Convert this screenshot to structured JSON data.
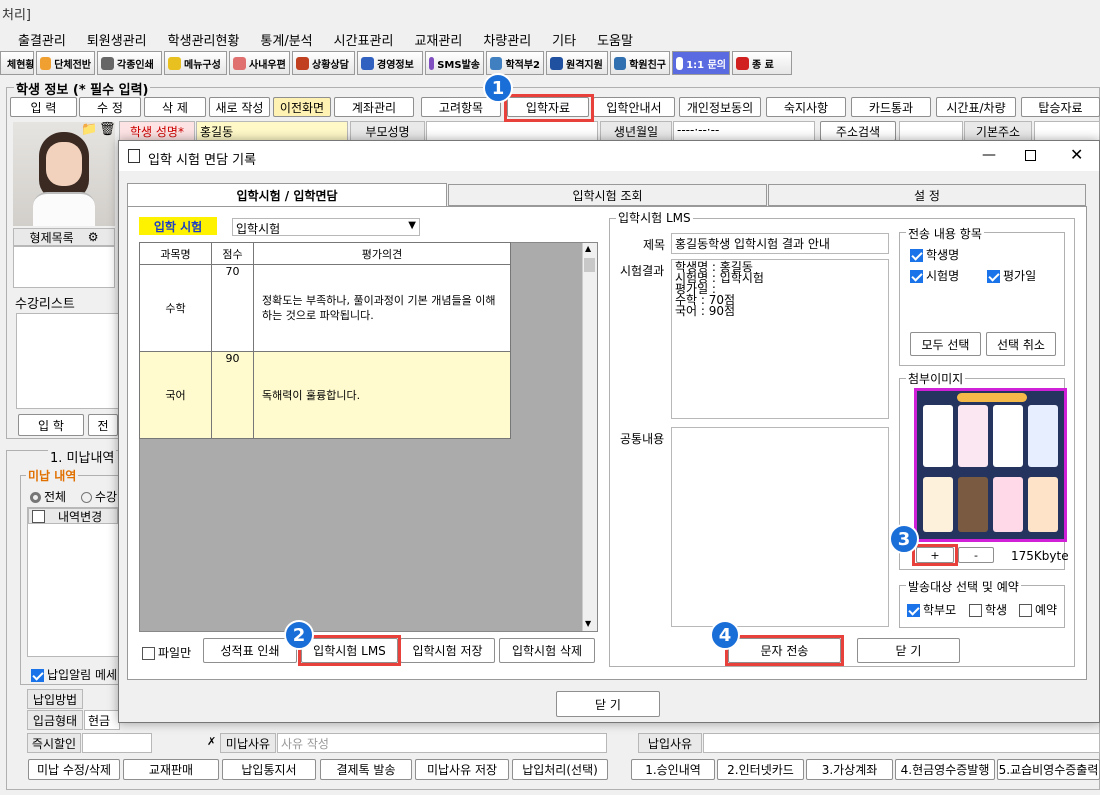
{
  "window_title": "처리]",
  "menu": [
    "출결관리",
    "퇴원생관리",
    "학생관리현황",
    "통계/분석",
    "시간표관리",
    "교재관리",
    "차량관리",
    "기타",
    "도움말"
  ],
  "toolbar": [
    "체현황",
    "단체전반",
    "각종인쇄",
    "메뉴구성",
    "사내우편",
    "상황상담",
    "경영정보",
    "SMS발송",
    "학적부2",
    "원격지원",
    "학원친구",
    "1:1 문의",
    "종 료"
  ],
  "student": {
    "section_title": "학생 정보 (* 필수 입력)",
    "buttons": [
      "입 력",
      "수 정",
      "삭 제",
      "새로 작성",
      "이전화면",
      "계좌관리",
      "고려항목",
      "입학자료",
      "입학안내서",
      "개인정보동의",
      "숙지사항",
      "카드통과",
      "시간표/차량",
      "탑승자료"
    ],
    "name_label": "학생 성명*",
    "name_value": "홍길동",
    "parent_label": "부모성명",
    "birth_label": "생년월일",
    "birth_value": "----·--·--",
    "address_search": "주소검색",
    "base_address": "기본주소",
    "sibling_label": "형제목록",
    "course_list": "수강리스트",
    "enroll_btn": "입 학",
    "enroll_btn2": "전"
  },
  "unpaid": {
    "header": "1. 미납내역",
    "title": "미납 내역",
    "all": "전체",
    "course": "수강",
    "col_change": "내역변경",
    "alarm": "납입알림 메세",
    "pay_method": "납입방법",
    "pay_type": "입금형태",
    "pay_type_value": "현금",
    "instant_discount": "즉시할인",
    "unpaid_reason": "미납사유",
    "reason_placeholder": "사유 작성",
    "pay_reason": "납입사유",
    "bottom_buttons": [
      "미납 수정/삭제",
      "교재판매",
      "납입통지서",
      "결제톡 발송",
      "미납사유 저장",
      "납입처리(선택)"
    ],
    "bottom_buttons2": [
      "1.승인내역",
      "2.인터넷카드",
      "3.가상계좌",
      "4.현금영수증발행",
      "5.교습비영수증출력"
    ]
  },
  "dialog": {
    "title": "입학 시험 면담 기록",
    "tabs": [
      "입학시험 / 입학면담",
      "입학시험 조회",
      "설 정"
    ],
    "exam_label": "입학 시험",
    "exam_select": "입학시험",
    "table_headers": [
      "과목명",
      "점수",
      "평가의견"
    ],
    "rows": [
      {
        "subject": "수학",
        "score": "70",
        "comment": "정확도는 부족하나, 풀이과정이 기본 개념들을 이해하는 것으로 파악됩니다."
      },
      {
        "subject": "국어",
        "score": "90",
        "comment": "독해력이 훌륭합니다."
      }
    ],
    "file_only": "파일만",
    "buttons": [
      "성적표 인쇄",
      "입학시험 LMS",
      "입학시험 저장",
      "입학시험 삭제"
    ],
    "lms": {
      "group": "입학시험 LMS",
      "subject_label": "제목",
      "subject_value": "홍길동학생 입학시험 결과 안내",
      "result_label": "시험결과",
      "result_lines": [
        "학생명 : 홍길동",
        "시험명 : 입학시험",
        "평가일 :",
        "수학 : 70점",
        "국어 : 90점"
      ],
      "common_label": "공통내용"
    },
    "send_items": {
      "title": "전송 내용 항목",
      "items": [
        "학생명",
        "시험명",
        "평가일"
      ],
      "select_all": "모두 선택",
      "deselect": "선택 취소"
    },
    "attach": {
      "title": "첨부이미지",
      "plus": "+",
      "minus": "-",
      "size": "175Kbyte"
    },
    "target": {
      "title": "발송대상 선택 및 예약",
      "items": [
        "학부모",
        "학생",
        "예약"
      ]
    },
    "send_btn": "문자 전송",
    "close_btn": "닫 기",
    "close_bottom": "닫 기"
  },
  "badges": [
    "1",
    "2",
    "3",
    "4"
  ]
}
